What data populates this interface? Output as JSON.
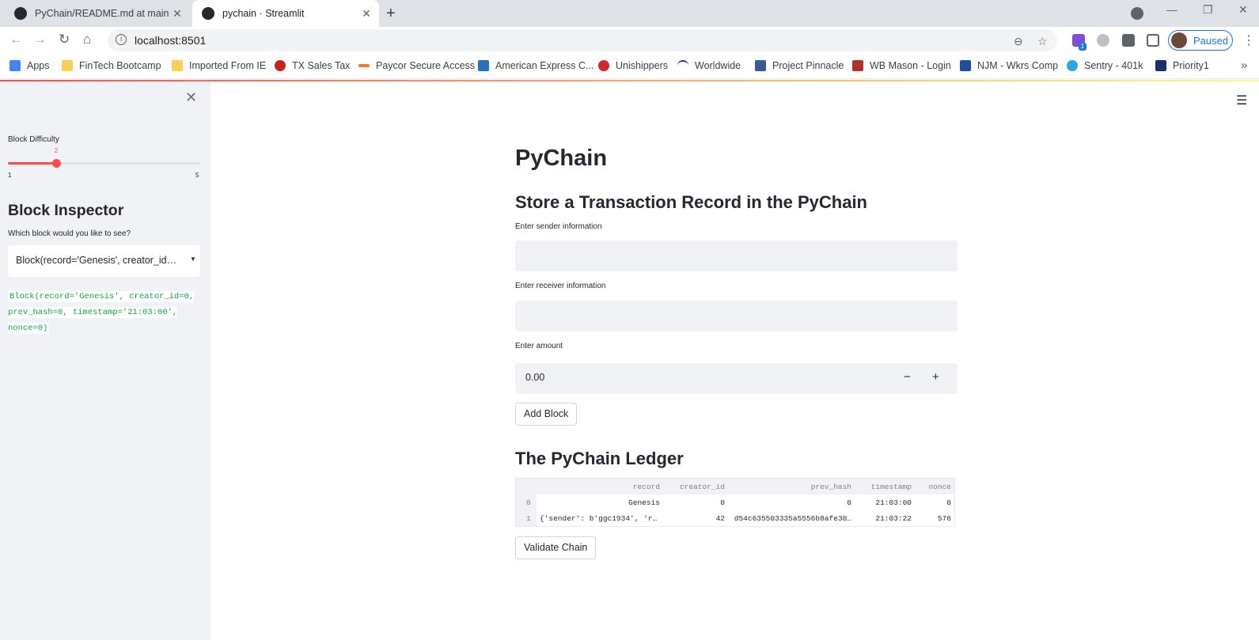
{
  "browser": {
    "tabs": [
      {
        "title": "PyChain/README.md at main · G",
        "active": false
      },
      {
        "title": "pychain · Streamlit",
        "active": true
      }
    ],
    "url": "localhost:8501",
    "profile_status": "Paused",
    "extension_badge": "1",
    "bookmarks": [
      {
        "label": "Apps",
        "icon": "apps-grid-icon",
        "color": "#4285f4"
      },
      {
        "label": "FinTech Bootcamp",
        "icon": "folder-icon",
        "color": "#f9cf58"
      },
      {
        "label": "Imported From IE",
        "icon": "folder-icon",
        "color": "#f9cf58"
      },
      {
        "label": "TX Sales Tax",
        "icon": "seal-icon",
        "color": "#c5221f"
      },
      {
        "label": "Paycor Secure Access",
        "icon": "paycor-icon",
        "color": "#f47b20"
      },
      {
        "label": "American Express C...",
        "icon": "amex-icon",
        "color": "#2671b9"
      },
      {
        "label": "Unishippers",
        "icon": "unishippers-icon",
        "color": "#d0282e"
      },
      {
        "label": "Worldwide",
        "icon": "swoosh-icon",
        "color": "#1a3e7a"
      },
      {
        "label": "Project Pinnacle",
        "icon": "building-icon",
        "color": "#3b5998"
      },
      {
        "label": "WB Mason - Login",
        "icon": "wbmason-icon",
        "color": "#b0322e"
      },
      {
        "label": "NJM - Wkrs Comp",
        "icon": "njm-icon",
        "color": "#1f4e9c"
      },
      {
        "label": "Sentry - 401k",
        "icon": "sentry-icon",
        "color": "#2aa6e0"
      },
      {
        "label": "Priority1",
        "icon": "priority-icon",
        "color": "#1b2f6b"
      }
    ]
  },
  "sidebar": {
    "slider": {
      "label": "Block Difficulty",
      "value": 2,
      "min": 1,
      "max": 5,
      "value_label": "2",
      "min_label": "1",
      "max_label": "5"
    },
    "heading": "Block Inspector",
    "question": "Which block would you like to see?",
    "select_value": "Block(record='Genesis', creator_id=0, prev_hash=0, timestamp='21:03:00', nonce=0)",
    "code_output": "Block(record='Genesis', creator_id=0, prev_hash=0, timestamp='21:03:00', nonce=0)"
  },
  "main": {
    "title": "PyChain",
    "subtitle": "Store a Transaction Record in the PyChain",
    "sender_label": "Enter sender information",
    "receiver_label": "Enter receiver information",
    "amount_label": "Enter amount",
    "amount_value": "0.00",
    "minus": "−",
    "plus": "+",
    "add_block_label": "Add Block",
    "ledger_title": "The PyChain Ledger",
    "validate_label": "Validate Chain",
    "ledger": {
      "columns": [
        "record",
        "creator_id",
        "prev_hash",
        "timestamp",
        "nonce"
      ],
      "rows": [
        {
          "index": "0",
          "record": "Genesis",
          "creator_id": "0",
          "prev_hash": "0",
          "timestamp": "21:03:00",
          "nonce": "0"
        },
        {
          "index": "1",
          "record": "{'sender': b'ggc1934', 'r…",
          "creator_id": "42",
          "prev_hash": "d54c635503335a5556b8afe30…",
          "timestamp": "21:03:22",
          "nonce": "576"
        }
      ]
    }
  },
  "colors": {
    "accent": "#ff4b4b",
    "code_green": "#09ab3b",
    "sidebar_bg": "#f0f2f6"
  }
}
